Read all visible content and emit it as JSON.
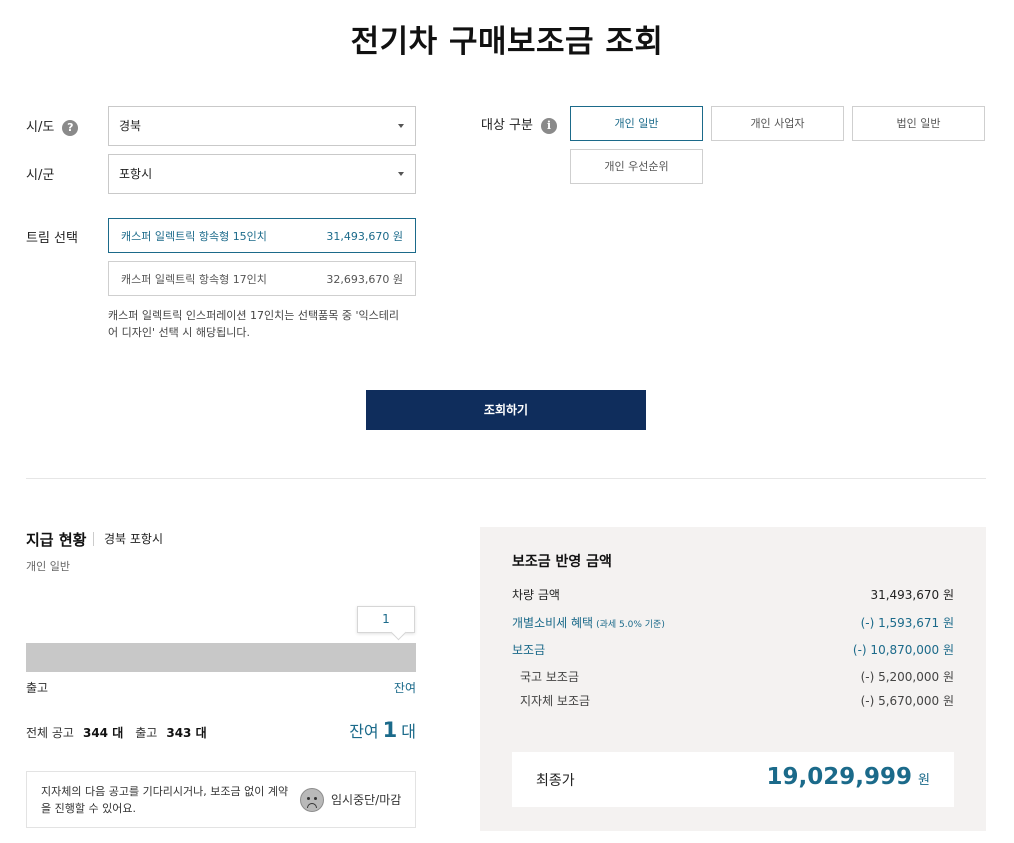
{
  "page": {
    "title": "전기차 구매보조금 조회"
  },
  "form": {
    "region_label": "시/도",
    "region_value": "경북",
    "city_label": "시/군",
    "city_value": "포항시",
    "trim_label": "트림 선택",
    "trims": [
      {
        "name": "캐스퍼 일렉트릭 항속형 15인치",
        "price": "31,493,670 원",
        "selected": true
      },
      {
        "name": "캐스퍼 일렉트릭 항속형 17인치",
        "price": "32,693,670 원",
        "selected": false
      }
    ],
    "trim_note": "캐스퍼 일렉트릭 인스퍼레이션 17인치는 선택품목 중 '익스테리어 디자인' 선택 시 해당됩니다.",
    "target_label": "대상 구분",
    "target_options": [
      {
        "label": "개인 일반",
        "selected": true
      },
      {
        "label": "개인 사업자",
        "selected": false
      },
      {
        "label": "법인 일반",
        "selected": false
      },
      {
        "label": "개인 우선순위",
        "selected": false
      }
    ],
    "search_button": "조회하기"
  },
  "status": {
    "title": "지급 현황",
    "region": "경북 포항시",
    "type": "개인 일반",
    "tooltip_value": "1",
    "released_label": "출고",
    "remaining_label": "잔여",
    "total_label": "전체 공고",
    "total_value": "344 대",
    "released_count_label": "출고",
    "released_value": "343 대",
    "remaining_prefix": "잔여",
    "remaining_number": "1",
    "remaining_unit": "대",
    "released_fraction": 0.997,
    "alert_text": "지자체의 다음 공고를 기다리시거나, 보조금 없이 계약을 진행할 수 있어요.",
    "alert_status": "임시중단/마감"
  },
  "summary": {
    "title": "보조금 반영 금액",
    "vehicle_label": "차량 금액",
    "vehicle_value": "31,493,670 원",
    "tax_label": "개별소비세 혜택",
    "tax_note": "(과세 5.0% 기준)",
    "tax_value": "(-) 1,593,671 원",
    "subsidy_label": "보조금",
    "subsidy_value": "(-) 10,870,000 원",
    "national_label": "국고 보조금",
    "national_value": "(-) 5,200,000 원",
    "local_label": "지자체 보조금",
    "local_value": "(-) 5,670,000 원",
    "final_label": "최종가",
    "final_value": "19,029,999",
    "final_unit": "원"
  },
  "colors": {
    "accent": "#1b6a8a",
    "button": "#0f2d5c",
    "panel": "#f4f2f1"
  }
}
